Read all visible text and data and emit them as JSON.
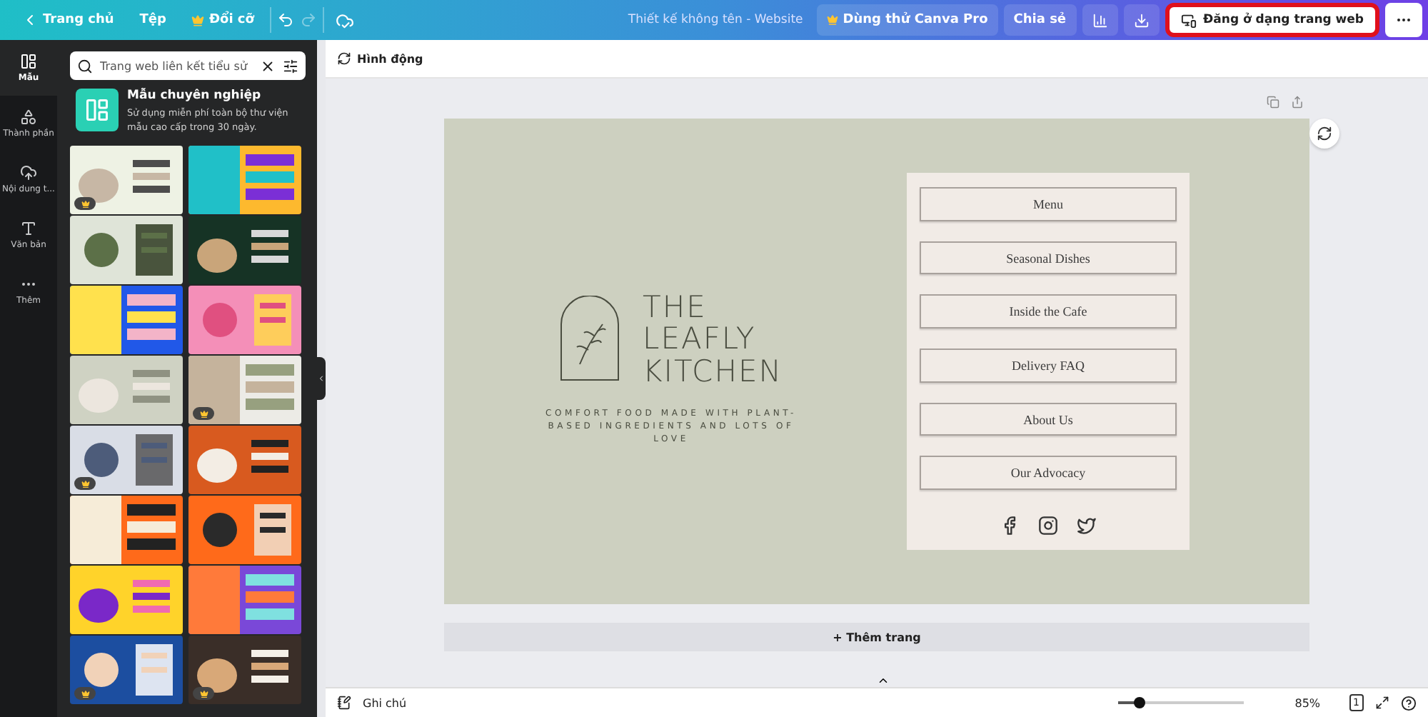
{
  "topbar": {
    "back": "Trang chủ",
    "file": "Tệp",
    "resize": "Đổi cỡ",
    "redo_disabled": true,
    "title": "Thiết kế không tên - Website",
    "pro_button": "Dùng thử Canva Pro",
    "share": "Chia sẻ",
    "publish": {
      "label": "Đăng ở dạng trang web",
      "highlighted": true
    }
  },
  "rail": [
    {
      "kind": "templates",
      "label": "Mẫu",
      "selected": true
    },
    {
      "kind": "elements",
      "label": "Thành phần",
      "selected": false
    },
    {
      "kind": "uploads",
      "label": "Nội dung t...",
      "selected": false
    },
    {
      "kind": "text",
      "label": "Văn bản",
      "selected": false
    },
    {
      "kind": "more",
      "label": "Thêm",
      "selected": false
    }
  ],
  "panel": {
    "search": {
      "value": "Trang web liên kết tiểu sử"
    },
    "promo": {
      "title": "Mẫu chuyên nghiệp",
      "text": "Sử dụng miễn phí toàn bộ thư viện mẫu cao cấp trong 30 ngày."
    },
    "templates": [
      {
        "kind": "picture",
        "premium": true
      },
      {
        "kind": "picture",
        "premium": false
      },
      {
        "kind": "picture",
        "premium": false
      },
      {
        "kind": "picture",
        "premium": false
      },
      {
        "kind": "picture",
        "premium": false
      },
      {
        "kind": "picture",
        "premium": false
      },
      {
        "kind": "picture",
        "premium": false
      },
      {
        "kind": "picture",
        "premium": true
      },
      {
        "kind": "picture",
        "premium": true
      },
      {
        "kind": "picture",
        "premium": false
      },
      {
        "kind": "picture",
        "premium": false
      },
      {
        "kind": "picture",
        "premium": false
      },
      {
        "kind": "picture",
        "premium": false
      },
      {
        "kind": "picture",
        "premium": false
      },
      {
        "kind": "picture",
        "premium": true
      },
      {
        "kind": "picture",
        "premium": true
      }
    ]
  },
  "toolbar": {
    "animate": "Hình động"
  },
  "design": {
    "brand": [
      "THE",
      "LEAFLY",
      "KITCHEN"
    ],
    "tagline": "COMFORT FOOD MADE WITH PLANT-BASED INGREDIENTS AND LOTS OF LOVE",
    "menu": [
      "Menu",
      "Seasonal Dishes",
      "Inside the Cafe",
      "Delivery FAQ",
      "About Us",
      "Our Advocacy"
    ]
  },
  "add_page": "+ Thêm trang",
  "bottombar": {
    "notes": "Ghi chú",
    "zoom": {
      "level": 0.17
    },
    "zoom_reading": "85%",
    "page_count": "1"
  }
}
